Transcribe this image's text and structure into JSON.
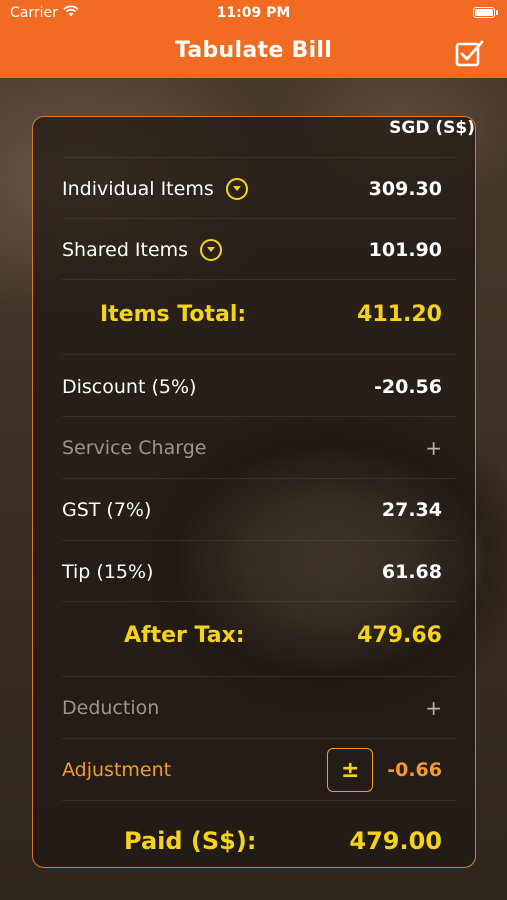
{
  "status": {
    "carrier": "Carrier",
    "time": "11:09 PM"
  },
  "nav": {
    "title": "Tabulate Bill"
  },
  "currency": "SGD (S$)",
  "rows": {
    "individual": {
      "label": "Individual Items",
      "value": "309.30"
    },
    "shared": {
      "label": "Shared Items",
      "value": "101.90"
    },
    "items_total": {
      "label": "Items Total:",
      "value": "411.20"
    },
    "discount": {
      "label": "Discount (5%)",
      "value": "-20.56"
    },
    "service": {
      "label": "Service Charge",
      "action": "+"
    },
    "gst": {
      "label": "GST (7%)",
      "value": "27.34"
    },
    "tip": {
      "label": "Tip (15%)",
      "value": "61.68"
    },
    "after_tax": {
      "label": "After Tax:",
      "value": "479.66"
    },
    "deduction": {
      "label": "Deduction",
      "action": "+"
    },
    "adjustment": {
      "label": "Adjustment",
      "button": "±",
      "value": "-0.66"
    },
    "paid": {
      "label": "Paid (S$):",
      "value": "479.00"
    }
  },
  "colors": {
    "accent": "#f26b22",
    "highlight": "#f5d21c",
    "adjust": "#f39a2c"
  },
  "icons": [
    "wifi-icon",
    "battery-icon",
    "edit-checkbox-icon",
    "chevron-down-circle-icon",
    "plus-icon",
    "plus-minus-icon"
  ]
}
